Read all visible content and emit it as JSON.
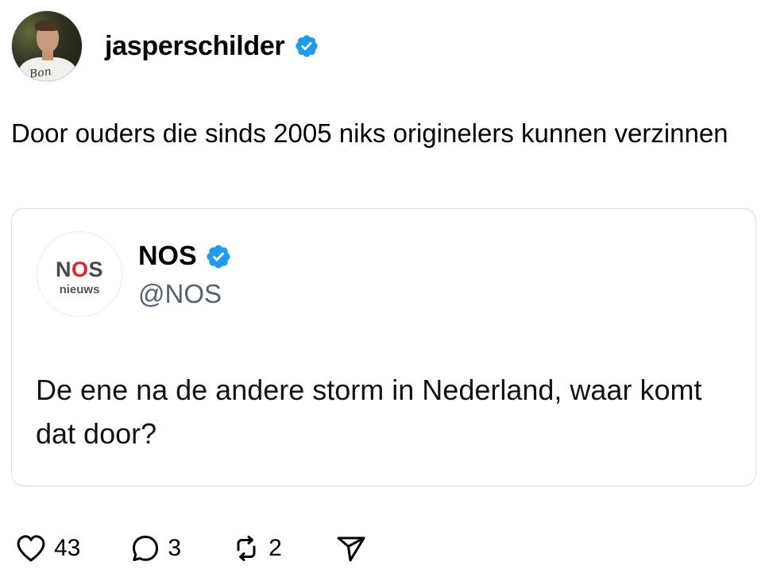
{
  "post": {
    "username": "jasperschilder",
    "avatar_caption": "Bon",
    "text": "Door ouders die sinds 2005 niks originelers kunnen verzinnen",
    "verified_color": "#1d9bf0"
  },
  "quote": {
    "logo_word_prefix": "N",
    "logo_word_accent": "O",
    "logo_word_suffix": "S",
    "logo_sub": "nieuws",
    "name": "NOS",
    "handle": "@NOS",
    "text": "De ene na de andere storm in Nederland, waar komt dat door?"
  },
  "actions": {
    "likes": "43",
    "replies": "3",
    "reposts": "2",
    "icons": [
      "heart-icon",
      "comment-icon",
      "repost-icon",
      "share-icon"
    ]
  }
}
